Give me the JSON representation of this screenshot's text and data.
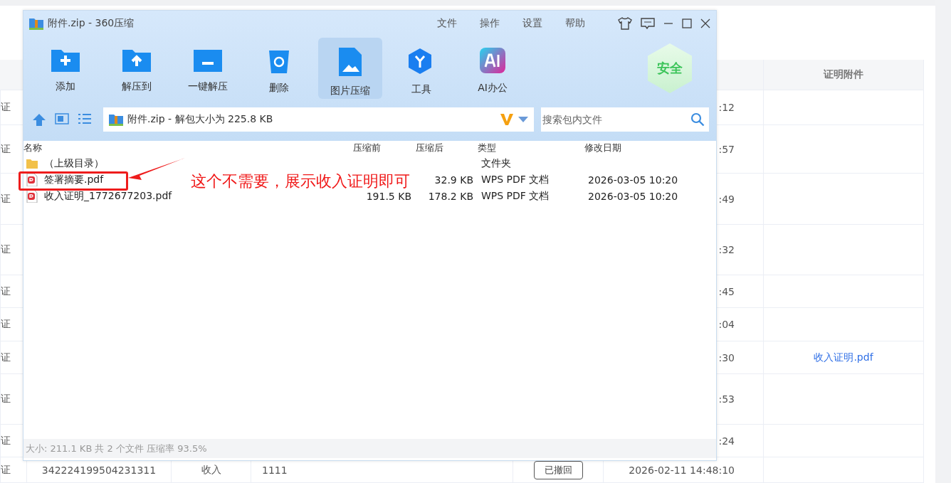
{
  "page_table": {
    "header": "证明附件",
    "rows": [
      {
        "column_1": "证",
        "time": ":12"
      },
      {
        "column_1": "证",
        "time": ":57"
      },
      {
        "column_1": "证",
        "time": ":49"
      },
      {
        "column_1": "证",
        "time": ":32"
      },
      {
        "column_1": "证",
        "time": ":45"
      },
      {
        "column_1": "证",
        "time": ":04"
      },
      {
        "column_1": "证",
        "time": ":30",
        "attachment": "收入证明.pdf"
      },
      {
        "column_1": "证",
        "time": ":53"
      },
      {
        "column_1": "证",
        "time": ":24"
      },
      {
        "column_1": "证",
        "id": "342224199504231311",
        "type": "收入",
        "amount": "1111",
        "status": "已撤回",
        "time": "2026-02-11 14:48:10"
      }
    ]
  },
  "archive_window": {
    "title": "附件.zip - 360压缩",
    "menu": [
      "文件",
      "操作",
      "设置",
      "帮助"
    ],
    "toolbar": [
      {
        "label": "添加",
        "selected": false
      },
      {
        "label": "解压到",
        "selected": false
      },
      {
        "label": "一键解压",
        "selected": false
      },
      {
        "label": "删除",
        "selected": false
      },
      {
        "label": "图片压缩",
        "selected": true
      },
      {
        "label": "工具",
        "selected": false
      },
      {
        "label": "AI办公",
        "selected": false
      }
    ],
    "badge": "安全",
    "path": "附件.zip - 解包大小为 225.8 KB",
    "search": {
      "placeholder": "搜索包内文件"
    },
    "columns": [
      "名称",
      "压缩前",
      "压缩后",
      "类型",
      "修改日期"
    ],
    "files": [
      {
        "kind": "folder",
        "name": "（上级目录）",
        "type": "文件夹"
      },
      {
        "kind": "pdf",
        "name": "签署摘要.pdf",
        "packed": "32.9 KB",
        "type": "WPS PDF 文档",
        "modified": "2026-03-05 10:20"
      },
      {
        "kind": "pdf",
        "name": "收入证明_1772677203.pdf",
        "original": "191.5 KB",
        "packed": "178.2 KB",
        "type": "WPS PDF 文档",
        "modified": "2026-03-05 10:20"
      }
    ],
    "status": "大小: 211.1 KB 共 2 个文件 压缩率 93.5%"
  },
  "annotation": {
    "text": "这个不需要，展示收入证明即可"
  }
}
